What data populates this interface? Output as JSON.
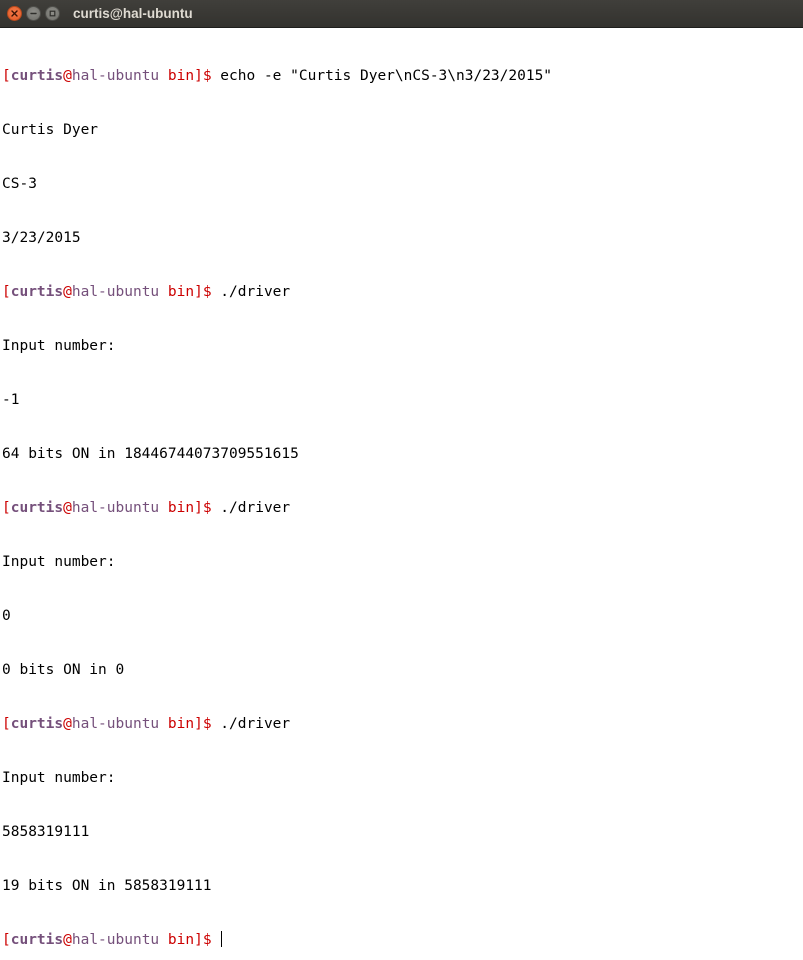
{
  "window": {
    "title": "curtis@hal-ubuntu",
    "controls": [
      "close-icon",
      "minimize-icon",
      "maximize-icon"
    ]
  },
  "colors": {
    "prompt_bracket": "#cc0000",
    "prompt_user": "#75507b",
    "prompt_host": "#75507b",
    "prompt_dir": "#cc0000",
    "titlebar": "#3a3935",
    "close_button": "#e95420"
  },
  "prompt": {
    "open_bracket": "[",
    "user": "curtis",
    "at": "@",
    "host": "hal-ubuntu",
    "space": " ",
    "dir": "bin",
    "close_bracket": "]",
    "dollar": "$"
  },
  "terminal": {
    "line0": {
      "command": " echo -e \"Curtis Dyer\\nCS-3\\n3/23/2015\""
    },
    "line1": {
      "text": "Curtis Dyer"
    },
    "line2": {
      "text": "CS-3"
    },
    "line3": {
      "text": "3/23/2015"
    },
    "line4": {
      "command": " ./driver"
    },
    "line5": {
      "text": "Input number:"
    },
    "line6": {
      "text": "-1"
    },
    "line7": {
      "text": "64 bits ON in 18446744073709551615"
    },
    "line8": {
      "command": " ./driver"
    },
    "line9": {
      "text": "Input number:"
    },
    "line10": {
      "text": "0"
    },
    "line11": {
      "text": "0 bits ON in 0"
    },
    "line12": {
      "command": " ./driver"
    },
    "line13": {
      "text": "Input number:"
    },
    "line14": {
      "text": "5858319111"
    },
    "line15": {
      "text": "19 bits ON in 5858319111"
    },
    "line16": {
      "command": " "
    }
  }
}
